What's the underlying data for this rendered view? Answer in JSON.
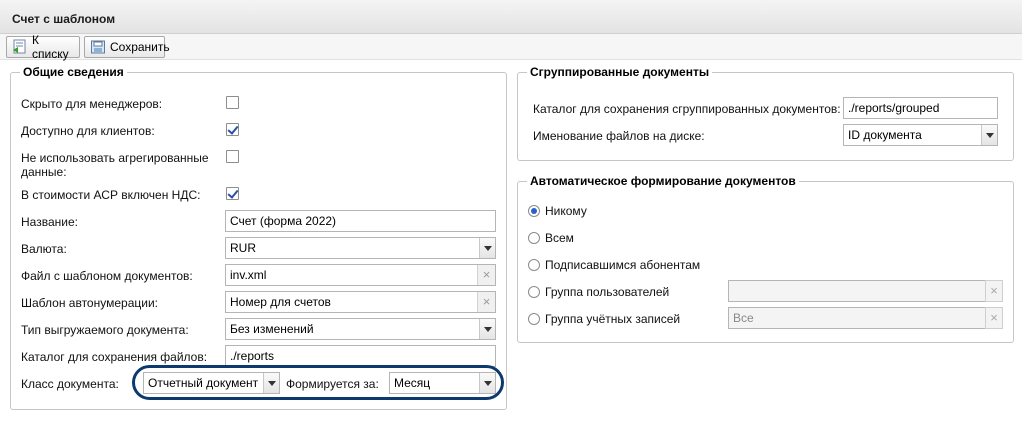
{
  "window": {
    "title": "Счет с шаблоном"
  },
  "toolbar": {
    "back_label": "К списку",
    "save_label": "Сохранить",
    "back_icon": "list-back-icon",
    "save_icon": "save-icon"
  },
  "general": {
    "legend": "Общие сведения",
    "hidden_for_managers": {
      "label": "Скрыто для менеджеров:",
      "checked": false
    },
    "available_for_clients": {
      "label": "Доступно для клиентов:",
      "checked": true
    },
    "no_aggregated_data": {
      "label_line1": "Не использовать агрегированные",
      "label_line2": "данные:",
      "checked": false
    },
    "vat_included": {
      "label": "В стоимости АСР включен НДС:",
      "checked": true
    },
    "name": {
      "label": "Название:",
      "value": "Счет (форма 2022)"
    },
    "currency": {
      "label": "Валюта:",
      "value": "RUR"
    },
    "template_file": {
      "label": "Файл с шаблоном документов:",
      "value": "inv.xml"
    },
    "autonumber_template": {
      "label": "Шаблон автонумерации:",
      "value": "Номер для счетов"
    },
    "export_type": {
      "label": "Тип выгружаемого документа:",
      "value": "Без изменений"
    },
    "save_dir": {
      "label": "Каталог для сохранения файлов:",
      "value": "./reports"
    },
    "doc_class": {
      "label": "Класс документа:",
      "value": "Отчетный документ"
    },
    "formed_for": {
      "label": "Формируется за:",
      "value": "Месяц"
    }
  },
  "grouped": {
    "legend": "Сгруппированные документы",
    "dir": {
      "label": "Каталог для сохранения сгруппированных документов:",
      "value": "./reports/grouped"
    },
    "file_naming": {
      "label": "Именование файлов на диске:",
      "value": "ID документа"
    }
  },
  "auto": {
    "legend": "Автоматическое формирование документов",
    "options": [
      {
        "label": "Никому",
        "selected": true
      },
      {
        "label": "Всем",
        "selected": false
      },
      {
        "label": "Подписавшимся абонентам",
        "selected": false
      },
      {
        "label": "Группа пользователей",
        "selected": false,
        "value": ""
      },
      {
        "label": "Группа учётных записей",
        "selected": false,
        "value": "Все"
      }
    ]
  },
  "colors": {
    "highlight_ring": "#0d3a6e",
    "accent": "#2b5fc9"
  }
}
